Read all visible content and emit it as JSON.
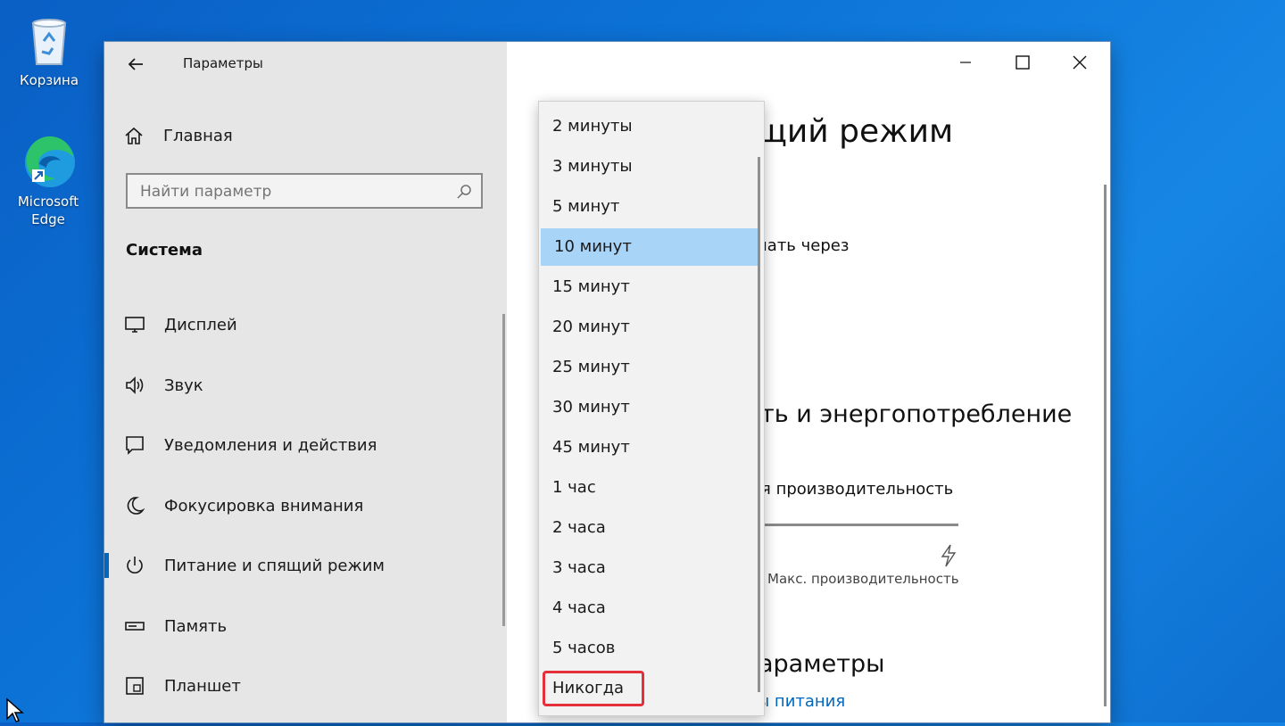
{
  "desktop": {
    "icons": [
      {
        "label": "Корзина"
      },
      {
        "label": "Microsoft Edge"
      }
    ]
  },
  "window": {
    "title": "Параметры",
    "home_label": "Главная",
    "search_placeholder": "Найти параметр",
    "section_title": "Система",
    "nav": [
      {
        "label": "Дисплей",
        "icon": "display-icon"
      },
      {
        "label": "Звук",
        "icon": "speaker-icon"
      },
      {
        "label": "Уведомления и действия",
        "icon": "notification-icon"
      },
      {
        "label": "Фокусировка внимания",
        "icon": "moon-icon"
      },
      {
        "label": "Питание и спящий режим",
        "icon": "power-icon",
        "active": true
      },
      {
        "label": "Память",
        "icon": "storage-icon"
      },
      {
        "label": "Планшет",
        "icon": "tablet-icon"
      }
    ]
  },
  "content": {
    "title_partial": "щий режим",
    "sleep_partial": "ючать через",
    "section2_partial": "ть и энергопотребление",
    "mode_partial": "ая производительность",
    "slider_right_label": "е Макс. производительность",
    "section3_partial": "араметры",
    "link_partial": "ы питания"
  },
  "dropdown": {
    "items": [
      "2 минуты",
      "3 минуты",
      "5 минут",
      "10 минут",
      "15 минут",
      "20 минут",
      "25 минут",
      "30 минут",
      "45 минут",
      "1 час",
      "2 часа",
      "3 часа",
      "4 часа",
      "5 часов",
      "Никогда"
    ],
    "selected": "10 минут",
    "highlighted": "Никогда"
  },
  "colors": {
    "accent": "#0067c0",
    "selection": "#a8d4f8",
    "highlight_box": "#e3303a"
  }
}
